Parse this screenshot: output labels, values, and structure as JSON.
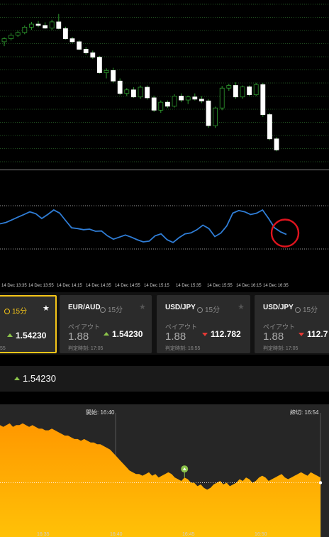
{
  "colors": {
    "bull": "#ffffff",
    "bear": "#000000",
    "wick": "#2e9b2e",
    "grid": "#2d6a2d",
    "indicator": "#2f7dd6",
    "highlight_circle": "#e0141e",
    "gold": "#f5c518",
    "area": "#ffa000",
    "up": "#8bc34a",
    "down": "#e53935"
  },
  "candles": [
    {
      "o": 63.5,
      "h": 64.5,
      "l": 62.5,
      "c": 64.2
    },
    {
      "o": 64.2,
      "h": 65.5,
      "l": 63.8,
      "c": 65.0
    },
    {
      "o": 65.0,
      "h": 66.0,
      "l": 64.6,
      "c": 65.6
    },
    {
      "o": 65.6,
      "h": 67.2,
      "l": 65.2,
      "c": 66.8
    },
    {
      "o": 66.8,
      "h": 68.0,
      "l": 66.2,
      "c": 67.5
    },
    {
      "o": 67.5,
      "h": 68.2,
      "l": 66.8,
      "c": 67.2
    },
    {
      "o": 67.2,
      "h": 67.9,
      "l": 66.4,
      "c": 66.6
    },
    {
      "o": 66.6,
      "h": 68.5,
      "l": 66.2,
      "c": 68.0
    },
    {
      "o": 68.0,
      "h": 69.8,
      "l": 66.3,
      "c": 66.5
    },
    {
      "o": 66.5,
      "h": 66.9,
      "l": 64.0,
      "c": 64.2
    },
    {
      "o": 64.2,
      "h": 64.6,
      "l": 63.2,
      "c": 63.5
    },
    {
      "o": 63.5,
      "h": 63.9,
      "l": 61.6,
      "c": 61.8
    },
    {
      "o": 61.8,
      "h": 62.3,
      "l": 60.6,
      "c": 61.0
    },
    {
      "o": 61.0,
      "h": 61.5,
      "l": 59.6,
      "c": 60.0
    },
    {
      "o": 60.0,
      "h": 60.3,
      "l": 56.3,
      "c": 56.5
    },
    {
      "o": 56.5,
      "h": 57.5,
      "l": 55.2,
      "c": 57.0
    },
    {
      "o": 57.0,
      "h": 57.6,
      "l": 54.2,
      "c": 54.6
    },
    {
      "o": 54.6,
      "h": 55.2,
      "l": 51.4,
      "c": 51.8
    },
    {
      "o": 51.8,
      "h": 53.0,
      "l": 51.2,
      "c": 52.6
    },
    {
      "o": 52.6,
      "h": 53.2,
      "l": 50.8,
      "c": 51.0
    },
    {
      "o": 51.0,
      "h": 53.6,
      "l": 50.6,
      "c": 53.2
    },
    {
      "o": 53.2,
      "h": 53.6,
      "l": 50.4,
      "c": 50.8
    },
    {
      "o": 50.8,
      "h": 51.3,
      "l": 47.6,
      "c": 48.0
    },
    {
      "o": 48.0,
      "h": 50.2,
      "l": 47.4,
      "c": 49.8
    },
    {
      "o": 49.8,
      "h": 50.2,
      "l": 48.5,
      "c": 48.9
    },
    {
      "o": 48.9,
      "h": 51.6,
      "l": 48.6,
      "c": 51.2
    },
    {
      "o": 51.2,
      "h": 51.8,
      "l": 49.8,
      "c": 50.3
    },
    {
      "o": 50.3,
      "h": 51.3,
      "l": 49.4,
      "c": 51.0
    },
    {
      "o": 51.0,
      "h": 51.8,
      "l": 50.2,
      "c": 50.5
    },
    {
      "o": 50.5,
      "h": 51.2,
      "l": 49.6,
      "c": 50.1
    },
    {
      "o": 50.1,
      "h": 50.5,
      "l": 44.0,
      "c": 44.5
    },
    {
      "o": 44.5,
      "h": 48.8,
      "l": 44.0,
      "c": 48.5
    },
    {
      "o": 48.5,
      "h": 53.5,
      "l": 48.0,
      "c": 53.0
    },
    {
      "o": 53.0,
      "h": 54.0,
      "l": 52.4,
      "c": 53.6
    },
    {
      "o": 53.6,
      "h": 54.3,
      "l": 50.6,
      "c": 51.0
    },
    {
      "o": 51.0,
      "h": 53.6,
      "l": 50.6,
      "c": 53.3
    },
    {
      "o": 53.3,
      "h": 53.6,
      "l": 51.2,
      "c": 51.5
    },
    {
      "o": 51.5,
      "h": 54.2,
      "l": 51.2,
      "c": 53.8
    },
    {
      "o": 53.8,
      "h": 54.2,
      "l": 46.5,
      "c": 47.0
    },
    {
      "o": 47.0,
      "h": 47.4,
      "l": 41.2,
      "c": 41.5
    },
    {
      "o": 41.5,
      "h": 41.9,
      "l": 38.7,
      "c": 39.0
    }
  ],
  "indicator_values": [
    42,
    42.5,
    43.5,
    44.5,
    45.5,
    46.5,
    45.8,
    44.0,
    45.5,
    47.2,
    46.0,
    43.2,
    40.5,
    40.2,
    39.8,
    40.0,
    39.2,
    39.3,
    37.5,
    36.2,
    37.0,
    37.8,
    37.0,
    36.0,
    35.2,
    35.5,
    37.5,
    38.2,
    36.0,
    35.0,
    36.8,
    38.2,
    38.6,
    39.8,
    41.5,
    40.2,
    37.2,
    38.5,
    41.2,
    46.0,
    47.0,
    46.5,
    45.5,
    46.0,
    47.2,
    44.0,
    40.5,
    39.0,
    38.0
  ],
  "time_axis": {
    "labels": [
      "14 Dec 13:35",
      "14 Dec 13:55",
      "14 Dec 14:15",
      "14 Dec 14:35",
      "14 Dec 14:55",
      "14 Dec 15:15",
      "14 Dec 15:35",
      "14 Dec 15:55",
      "14 Dec 16:15",
      "14 Dec 16:35"
    ]
  },
  "cards": [
    {
      "pair": "",
      "duration": "15分",
      "price": "1.54230",
      "direction": "up",
      "judge": "55",
      "active": true
    },
    {
      "pair": "EUR/AUD",
      "duration": "15分",
      "payout_label": "ペイアウト",
      "payout": "1.88",
      "price": "1.54230",
      "direction": "up",
      "judge": "判定時刻: 17:05",
      "active": false
    },
    {
      "pair": "USD/JPY",
      "duration": "15分",
      "payout_label": "ペイアウト",
      "payout": "1.88",
      "price": "112.782",
      "direction": "down",
      "judge": "判定時刻: 16:55",
      "active": false
    },
    {
      "pair": "USD/JPY",
      "duration": "15分",
      "payout_label": "ペイアウト",
      "payout": "1.88",
      "price": "112.7",
      "direction": "down",
      "judge": "判定時刻: 17:05",
      "active": false
    }
  ],
  "current_price": "1.54230",
  "area_chart": {
    "open_label": "開始: 16:40",
    "close_label": "締切: 16:54",
    "x_ticks": [
      "16:35",
      "16:40",
      "16:45",
      "16:50"
    ],
    "series": [
      88,
      87,
      88,
      89,
      87,
      88,
      88,
      89,
      88,
      87,
      88,
      87,
      86,
      86,
      85,
      85,
      86,
      85,
      84,
      83,
      82,
      82,
      81,
      80,
      80,
      79,
      80,
      79,
      78,
      78,
      77,
      77,
      76,
      75,
      74,
      72,
      70,
      68,
      66,
      64,
      62,
      61,
      60,
      60,
      59,
      60,
      61,
      59,
      60,
      58,
      59,
      60,
      61,
      60,
      58,
      57,
      56,
      58,
      57,
      55,
      55,
      53,
      54,
      52,
      51,
      52,
      54,
      55,
      56,
      54,
      55,
      53,
      54,
      55,
      57,
      56,
      58,
      57,
      55,
      56,
      58,
      59,
      58,
      56,
      57,
      58,
      59,
      60,
      58,
      57,
      58,
      59,
      60,
      61,
      60,
      59,
      61,
      60,
      59,
      58
    ],
    "reference_level": 55,
    "marker_index": 57
  }
}
